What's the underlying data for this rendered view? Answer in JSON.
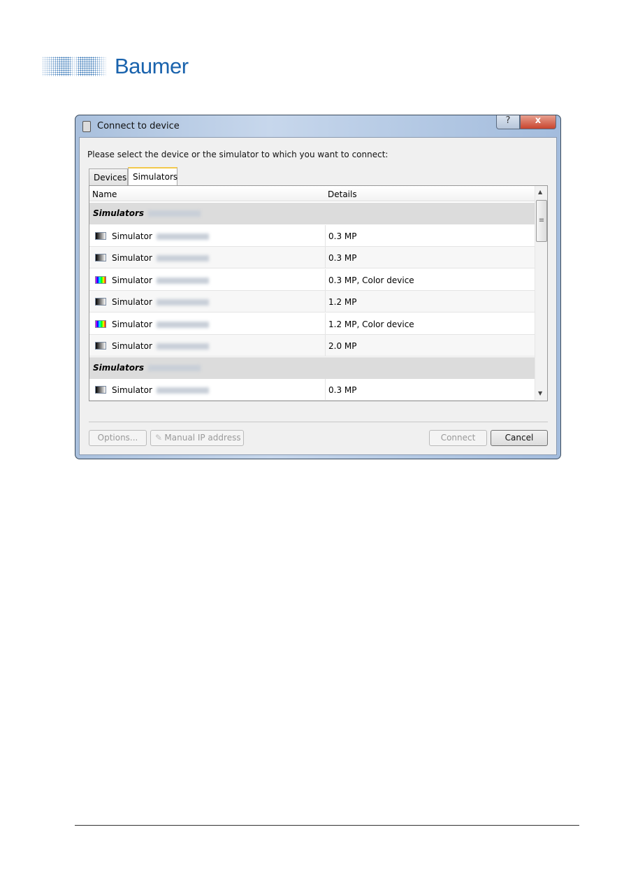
{
  "logo": {
    "brand": "Baumer"
  },
  "window": {
    "title": "Connect to device",
    "help_label": "?",
    "close_label": "x"
  },
  "instruction": "Please select the device or the simulator to which you want to connect:",
  "tabs": [
    {
      "label": "Devices",
      "active": false
    },
    {
      "label": "Simulators",
      "active": true
    }
  ],
  "table": {
    "headers": [
      "Name",
      "Details"
    ],
    "rows": [
      {
        "type": "group",
        "name": "Simulators"
      },
      {
        "type": "item",
        "name": "Simulator",
        "details": "0.3 MP",
        "icon": "mono-sensor-icon"
      },
      {
        "type": "item",
        "name": "Simulator",
        "details": "0.3 MP",
        "icon": "mono-sensor-icon"
      },
      {
        "type": "item",
        "name": "Simulator",
        "details": "0.3 MP, Color device",
        "icon": "color-sensor-icon"
      },
      {
        "type": "item",
        "name": "Simulator",
        "details": "1.2 MP",
        "icon": "mono-sensor-icon"
      },
      {
        "type": "item",
        "name": "Simulator",
        "details": "1.2 MP, Color device",
        "icon": "color-sensor-icon"
      },
      {
        "type": "item",
        "name": "Simulator",
        "details": "2.0 MP",
        "icon": "mono-sensor-icon"
      },
      {
        "type": "group",
        "name": "Simulators"
      },
      {
        "type": "item",
        "name": "Simulator",
        "details": "0.3 MP",
        "icon": "mono-sensor-icon"
      }
    ]
  },
  "buttons": {
    "options": "Options...",
    "manual_ip": "Manual IP address",
    "connect": "Connect",
    "cancel": "Cancel"
  }
}
